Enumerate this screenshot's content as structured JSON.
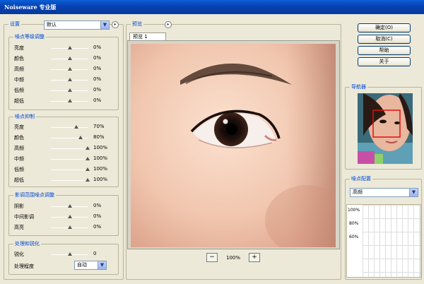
{
  "window": {
    "title": "Noiseware 专业版"
  },
  "settings": {
    "title": "设置",
    "preset_value": "默认",
    "noise_level": {
      "title": "噪点等级调整",
      "rows": [
        {
          "label": "亮度",
          "value": "0%",
          "level": 0.0
        },
        {
          "label": "颜色",
          "value": "0%",
          "level": 0.0
        },
        {
          "label": "高频",
          "value": "0%",
          "level": 0.0
        },
        {
          "label": "中频",
          "value": "0%",
          "level": 0.0
        },
        {
          "label": "低频",
          "value": "0%",
          "level": 0.0
        },
        {
          "label": "超低",
          "value": "0%",
          "level": 0.0
        }
      ]
    },
    "noise_reduction": {
      "title": "噪点抑制",
      "rows": [
        {
          "label": "亮度",
          "value": "70%",
          "level": 0.7
        },
        {
          "label": "颜色",
          "value": "80%",
          "level": 0.8
        },
        {
          "label": "高频",
          "value": "100%",
          "level": 1.0
        },
        {
          "label": "中频",
          "value": "100%",
          "level": 1.0
        },
        {
          "label": "低频",
          "value": "100%",
          "level": 1.0
        },
        {
          "label": "超低",
          "value": "100%",
          "level": 1.0
        }
      ]
    },
    "tonal_range": {
      "title": "影调范围噪点调整",
      "rows": [
        {
          "label": "阴影",
          "value": "0%",
          "level": 0.0
        },
        {
          "label": "中间影调",
          "value": "0%",
          "level": 0.0
        },
        {
          "label": "高亮",
          "value": "0%",
          "level": 0.0
        }
      ]
    },
    "post_processing": {
      "title": "处理和锐化",
      "sharpen_label": "锐化",
      "sharpen_value": "0",
      "degree_label": "处理程度",
      "degree_value": "自动"
    }
  },
  "preview": {
    "title": "预览",
    "tab_label": "预览 1",
    "zoom": "100%",
    "minus": "−",
    "plus": "+"
  },
  "buttons": {
    "ok": "确定(O)",
    "cancel": "取消(C)",
    "help": "帮助",
    "about": "关于"
  },
  "navigator": {
    "title": "导航器"
  },
  "noise_profile": {
    "title": "噪点配置",
    "select_value": "高频",
    "y_ticks": [
      "100%",
      "80%",
      "60%"
    ]
  }
}
